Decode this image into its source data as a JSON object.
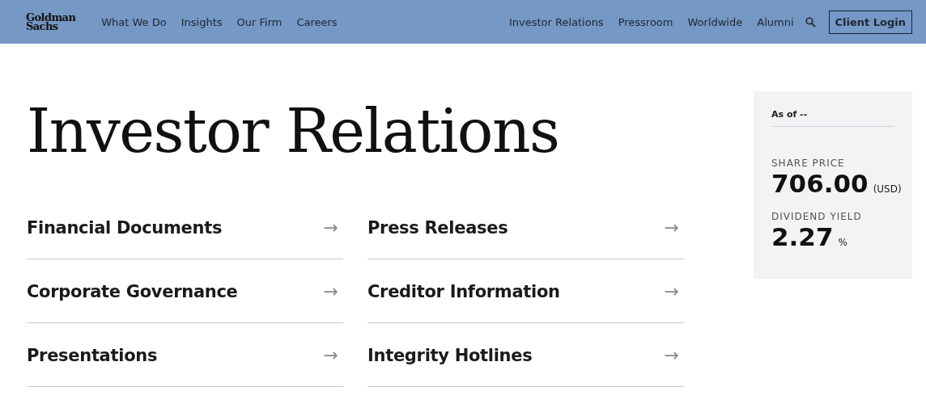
{
  "header": {
    "logo": [
      "Goldman",
      "Sachs"
    ],
    "nav_left": [
      "What We Do",
      "Insights",
      "Our Firm",
      "Careers"
    ],
    "nav_right": [
      "Investor Relations",
      "Pressroom",
      "Worldwide",
      "Alumni"
    ],
    "login_button": "Client Login"
  },
  "title": "Investor Relations",
  "links": [
    {
      "label": "Financial Documents",
      "arrow": "→"
    },
    {
      "label": "Press Releases",
      "arrow": "→"
    },
    {
      "label": "Corporate Governance",
      "arrow": "→"
    },
    {
      "label": "Creditor Information",
      "arrow": "→"
    },
    {
      "label": "Presentations",
      "arrow": "→"
    },
    {
      "label": "Integrity Hotlines",
      "arrow": "→"
    }
  ],
  "stock": {
    "as_of": "As of --",
    "share_price_label": "SHARE PRICE",
    "share_price": "706.00",
    "share_price_unit": "(USD)",
    "yield_label": "DIVIDEND YIELD",
    "yield": "2.27",
    "yield_unit": "%"
  }
}
